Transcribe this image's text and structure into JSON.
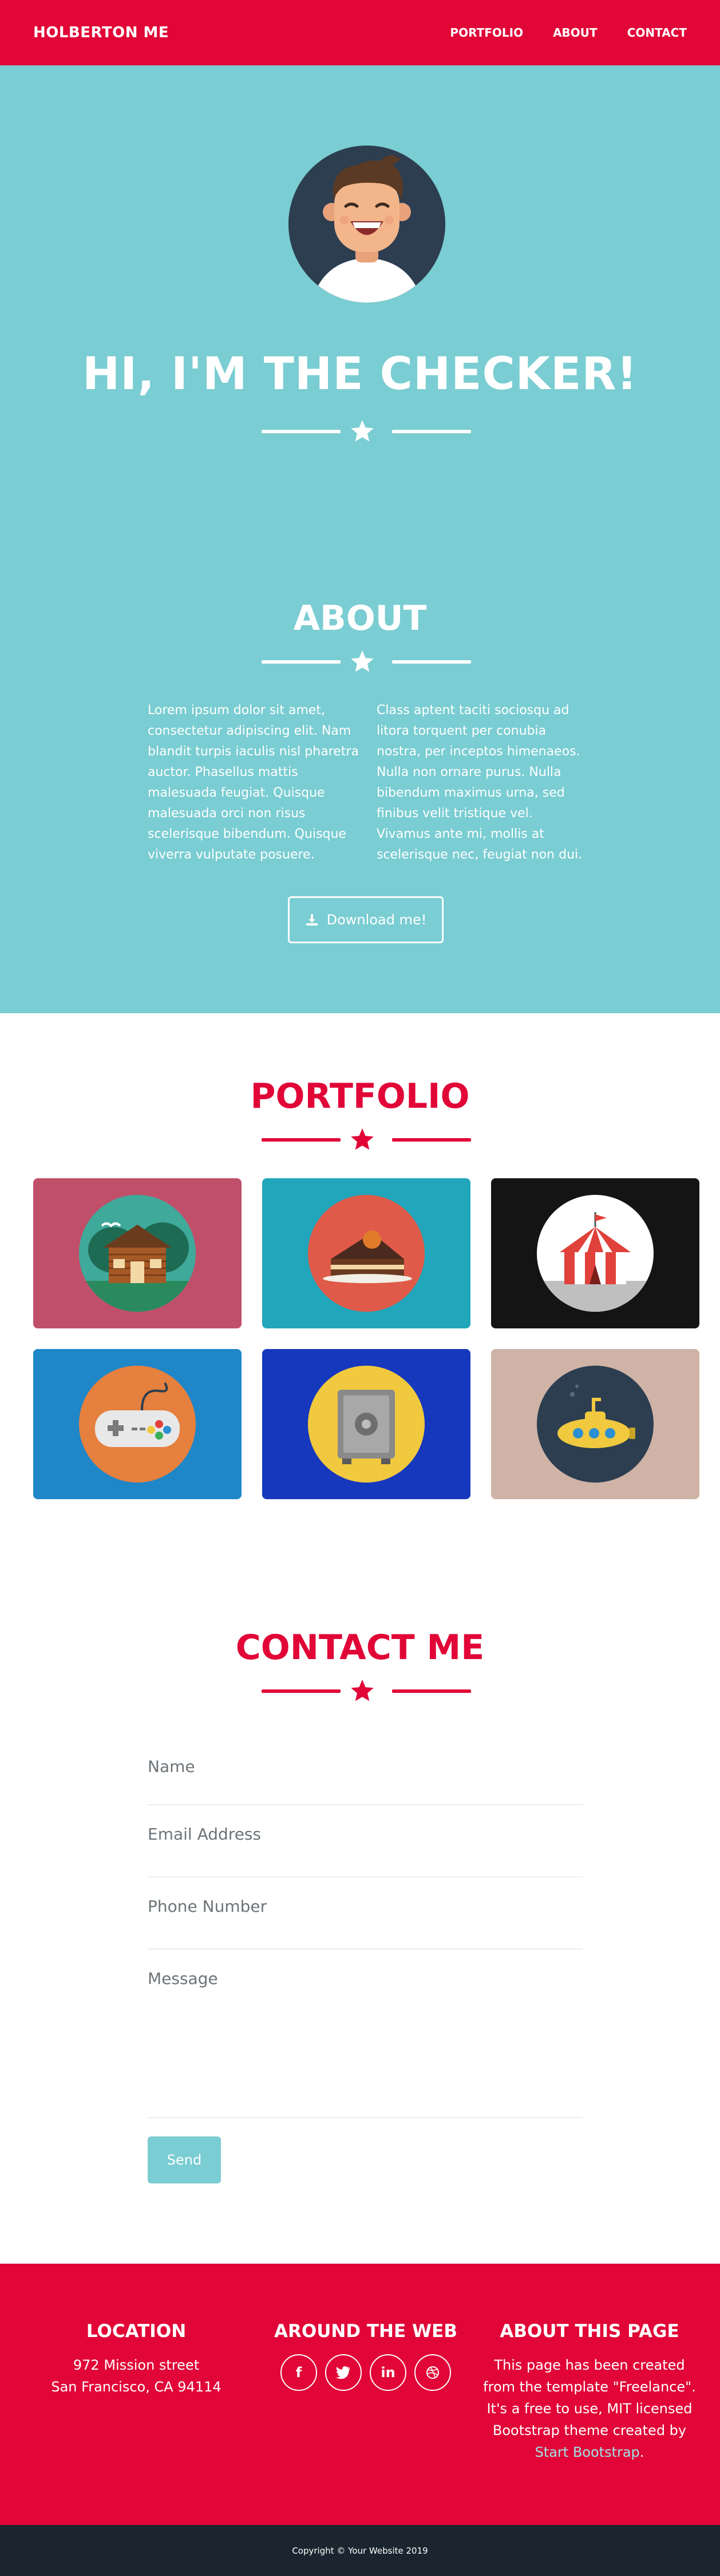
{
  "nav": {
    "brand": "HOLBERTON ME",
    "links": [
      "PORTFOLIO",
      "ABOUT",
      "CONTACT"
    ]
  },
  "hero": {
    "title": "HI, I'M THE CHECKER!"
  },
  "about": {
    "title": "ABOUT",
    "col1": "Lorem ipsum dolor sit amet, consectetur adipiscing elit. Nam blandit turpis iaculis nisl pharetra auctor. Phasellus mattis malesuada feugiat. Quisque malesuada orci non risus scelerisque bibendum. Quisque viverra vulputate posuere.",
    "col2": "Class aptent taciti sociosqu ad litora torquent per conubia nostra, per inceptos himenaeos. Nulla non ornare purus. Nulla bibendum maximus urna, sed finibus velit tristique vel. Vivamus ante mi, mollis at scelerisque nec, feugiat non dui.",
    "download_label": "Download me!"
  },
  "portfolio": {
    "title": "PORTFOLIO",
    "items": [
      {
        "name": "cabin",
        "bg": "#c0506a",
        "circle": "#3fa99a"
      },
      {
        "name": "cake",
        "bg": "#21a6bb",
        "circle": "#e05a49"
      },
      {
        "name": "circus-tent",
        "bg": "#141414",
        "circle": "#ffffff"
      },
      {
        "name": "game-controller",
        "bg": "#1f86c8",
        "circle": "#e5803e"
      },
      {
        "name": "safe",
        "bg": "#1638bd",
        "circle": "#f0c93e"
      },
      {
        "name": "submarine",
        "bg": "#cfb3a6",
        "circle": "#2c3e50"
      }
    ]
  },
  "contact": {
    "title": "CONTACT ME",
    "fields": {
      "name": "Name",
      "email": "Email Address",
      "phone": "Phone Number",
      "message": "Message"
    },
    "send_label": "Send"
  },
  "footer": {
    "location_title": "LOCATION",
    "address_line1": "972 Mission street",
    "address_line2": "San Francisco, CA 94114",
    "web_title": "AROUND THE WEB",
    "socials": [
      "f",
      "t",
      "in",
      "d"
    ],
    "about_title": "ABOUT THIS PAGE",
    "about_text": "This page has been created from the template \"Freelance\". It's a free to use, MIT licensed Bootstrap theme created by",
    "about_link": "Start Bootstrap",
    "about_end": ".",
    "copyright": "Copyright © Your Website 2019"
  },
  "colors": {
    "primary": "#e10637",
    "teal": "#7acdd2",
    "dark": "#1a252f"
  }
}
